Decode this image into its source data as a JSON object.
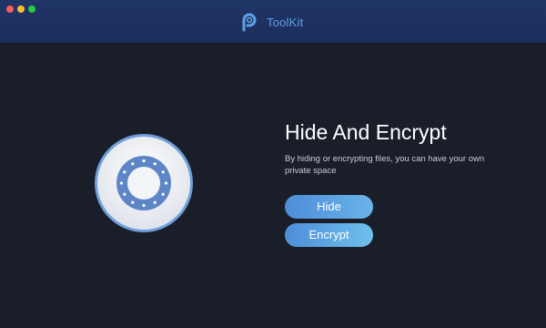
{
  "app": {
    "name": "ToolKit"
  },
  "window_controls": {
    "close": "close-button",
    "minimize": "minimize-button",
    "maximize": "maximize-button"
  },
  "main": {
    "title": "Hide And Encrypt",
    "description": "By hiding or encrypting files, you can have your own private space",
    "buttons": {
      "hide_label": "Hide",
      "encrypt_label": "Encrypt"
    }
  },
  "colors": {
    "background": "#1a1e29",
    "titlebar": "#1f3566",
    "accent": "#5ea0e6",
    "button_gradient_start": "#4e8ed8",
    "button_gradient_end": "#69b3ea"
  },
  "icons": {
    "logo": "toolkit-logo-icon",
    "feature": "vault-lock-icon"
  }
}
